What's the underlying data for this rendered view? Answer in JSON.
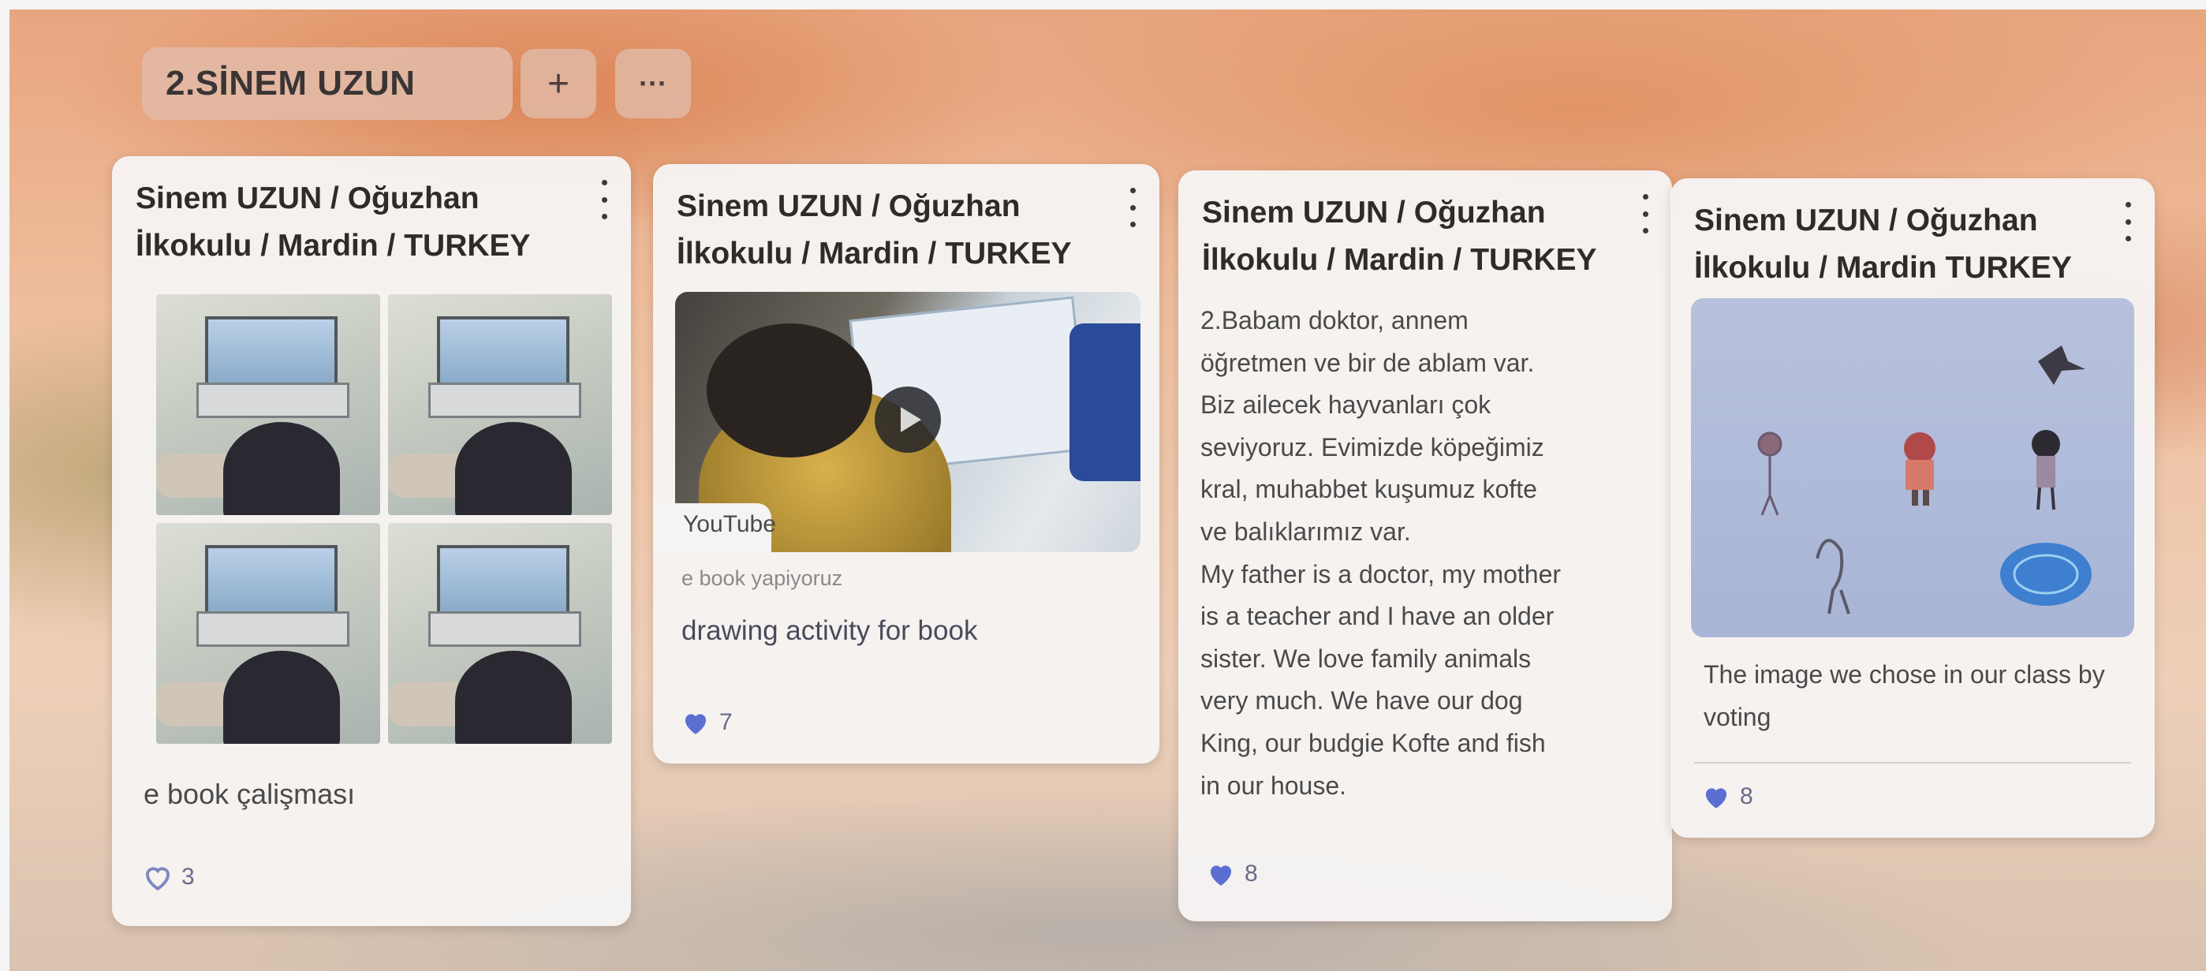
{
  "board": {
    "section_title": "2.SİNEM UZUN",
    "add_button_label": "+",
    "more_button_label": "···"
  },
  "cards": [
    {
      "author": "Sinem UZUN / Oğuzhan İlkokulu / Mardin / TURKEY",
      "media": "photo-collage",
      "caption": "e book çalişması",
      "likes": "3",
      "liked": false
    },
    {
      "author": "Sinem UZUN / Oğuzhan İlkokulu / Mardin / TURKEY",
      "media": "youtube-video",
      "media_source": "YouTube",
      "media_title": "e book yapiyoruz",
      "caption": "drawing activity for book",
      "likes": "7",
      "liked": true
    },
    {
      "author": "Sinem UZUN / Oğuzhan İlkokulu / Mardin / TURKEY",
      "body": "2.Babam doktor, annem\nöğretmen ve bir de ablam var.\nBiz ailecek hayvanları çok\nseviyoruz. Evimizde köpeğimiz\nkral, muhabbet kuşumuz kofte\nve balıklarımız var.\nMy father is a doctor, my mother\nis a teacher and I have an older\nsister. We love family animals\nvery much. We have our dog\nKing, our budgie Kofte and fish\nin our house.",
      "likes": "8",
      "liked": true
    },
    {
      "author": "Sinem UZUN / Oğuzhan İlkokulu / Mardin TURKEY",
      "media": "drawing-image",
      "caption": "The image we chose in our class by voting",
      "likes": "8",
      "liked": true
    }
  ],
  "colors": {
    "like_filled": "#5b6fd3",
    "card_background": "#f6f4f2",
    "section_tab": "#e2b9a5"
  },
  "icons": [
    "plus-icon",
    "more-horizontal-icon",
    "kebab-menu-icon",
    "heart-icon",
    "play-icon"
  ]
}
